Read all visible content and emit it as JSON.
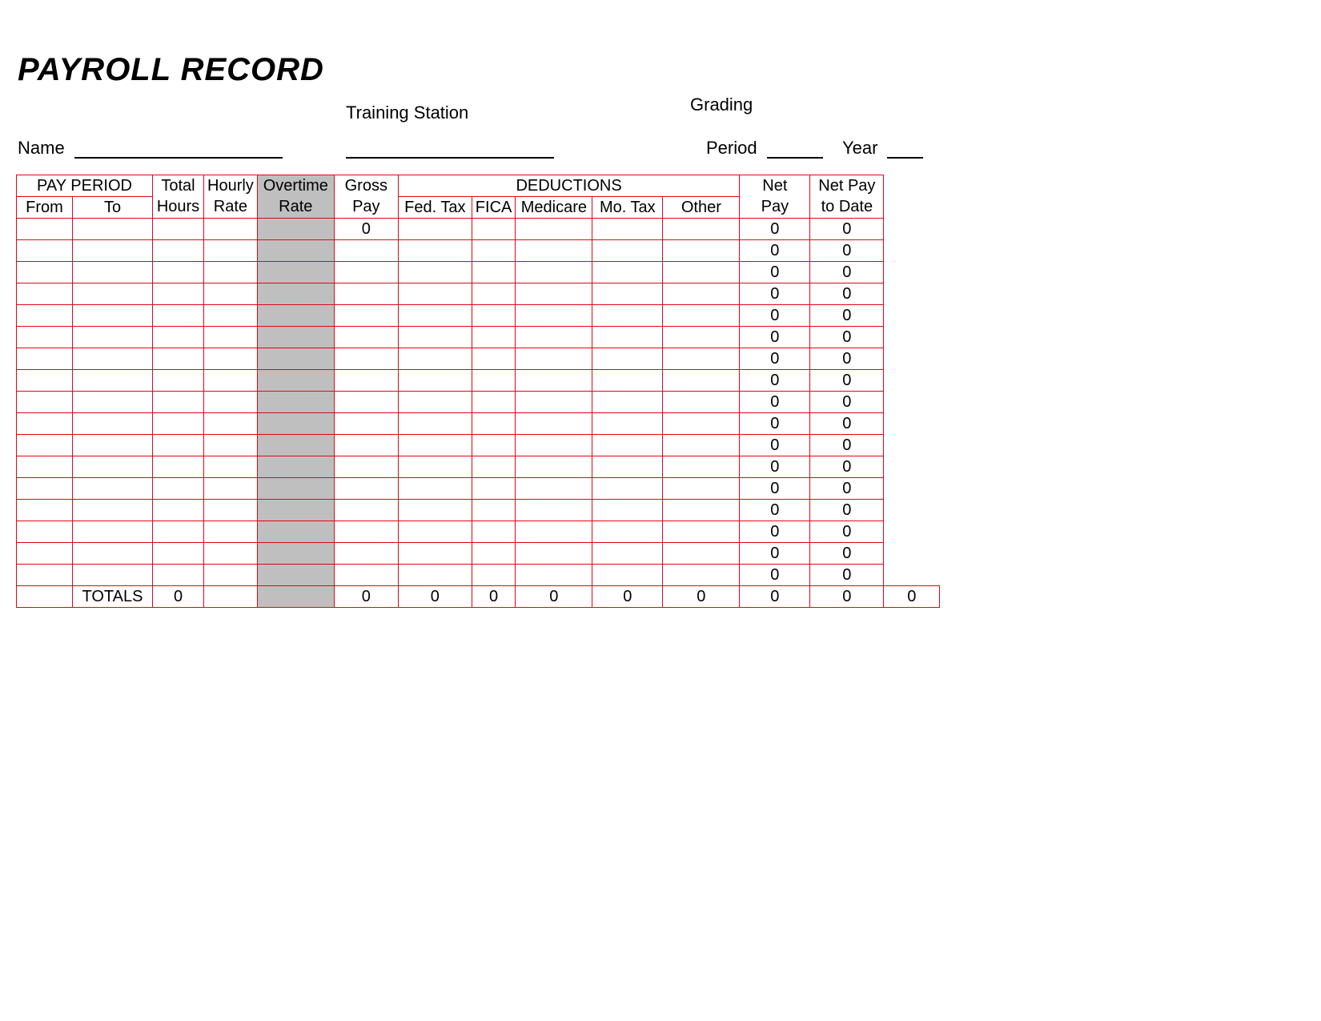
{
  "title": "PAYROLL RECORD",
  "header": {
    "name_label": "Name",
    "training_station_label": "Training Station",
    "grading_label": "Grading",
    "period_label": "Period",
    "year_label": "Year"
  },
  "columns": {
    "pay_period": "PAY PERIOD",
    "from": "From",
    "to": "To",
    "total_hours_1": "Total",
    "total_hours_2": "Hours",
    "hourly_rate_1": "Hourly",
    "hourly_rate_2": "Rate",
    "overtime_rate_1": "Overtime",
    "overtime_rate_2": "Rate",
    "gross_pay_1": "Gross",
    "gross_pay_2": "Pay",
    "deductions": "DEDUCTIONS",
    "fed_tax": "Fed. Tax",
    "fica": "FICA",
    "medicare": "Medicare",
    "mo_tax": "Mo. Tax",
    "other": "Other",
    "net_pay_1": "Net",
    "net_pay_2": "Pay",
    "net_pay_to_date_1": "Net Pay",
    "net_pay_to_date_2": "to Date"
  },
  "rows": [
    {
      "from": "",
      "to": "",
      "total_hours": "",
      "hourly_rate": "",
      "overtime_rate": "",
      "gross_pay": "0",
      "fed_tax": "",
      "fica": "",
      "medicare": "",
      "mo_tax": "",
      "other": "",
      "net_pay": "0",
      "net_pay_to_date": "0"
    },
    {
      "from": "",
      "to": "",
      "total_hours": "",
      "hourly_rate": "",
      "overtime_rate": "",
      "gross_pay": "",
      "fed_tax": "",
      "fica": "",
      "medicare": "",
      "mo_tax": "",
      "other": "",
      "net_pay": "0",
      "net_pay_to_date": "0"
    },
    {
      "from": "",
      "to": "",
      "total_hours": "",
      "hourly_rate": "",
      "overtime_rate": "",
      "gross_pay": "",
      "fed_tax": "",
      "fica": "",
      "medicare": "",
      "mo_tax": "",
      "other": "",
      "net_pay": "0",
      "net_pay_to_date": "0"
    },
    {
      "from": "",
      "to": "",
      "total_hours": "",
      "hourly_rate": "",
      "overtime_rate": "",
      "gross_pay": "",
      "fed_tax": "",
      "fica": "",
      "medicare": "",
      "mo_tax": "",
      "other": "",
      "net_pay": "0",
      "net_pay_to_date": "0"
    },
    {
      "from": "",
      "to": "",
      "total_hours": "",
      "hourly_rate": "",
      "overtime_rate": "",
      "gross_pay": "",
      "fed_tax": "",
      "fica": "",
      "medicare": "",
      "mo_tax": "",
      "other": "",
      "net_pay": "0",
      "net_pay_to_date": "0"
    },
    {
      "from": "",
      "to": "",
      "total_hours": "",
      "hourly_rate": "",
      "overtime_rate": "",
      "gross_pay": "",
      "fed_tax": "",
      "fica": "",
      "medicare": "",
      "mo_tax": "",
      "other": "",
      "net_pay": "0",
      "net_pay_to_date": "0"
    },
    {
      "from": "",
      "to": "",
      "total_hours": "",
      "hourly_rate": "",
      "overtime_rate": "",
      "gross_pay": "",
      "fed_tax": "",
      "fica": "",
      "medicare": "",
      "mo_tax": "",
      "other": "",
      "net_pay": "0",
      "net_pay_to_date": "0"
    },
    {
      "from": "",
      "to": "",
      "total_hours": "",
      "hourly_rate": "",
      "overtime_rate": "",
      "gross_pay": "",
      "fed_tax": "",
      "fica": "",
      "medicare": "",
      "mo_tax": "",
      "other": "",
      "net_pay": "0",
      "net_pay_to_date": "0"
    },
    {
      "from": "",
      "to": "",
      "total_hours": "",
      "hourly_rate": "",
      "overtime_rate": "",
      "gross_pay": "",
      "fed_tax": "",
      "fica": "",
      "medicare": "",
      "mo_tax": "",
      "other": "",
      "net_pay": "0",
      "net_pay_to_date": "0"
    },
    {
      "from": "",
      "to": "",
      "total_hours": "",
      "hourly_rate": "",
      "overtime_rate": "",
      "gross_pay": "",
      "fed_tax": "",
      "fica": "",
      "medicare": "",
      "mo_tax": "",
      "other": "",
      "net_pay": "0",
      "net_pay_to_date": "0"
    },
    {
      "from": "",
      "to": "",
      "total_hours": "",
      "hourly_rate": "",
      "overtime_rate": "",
      "gross_pay": "",
      "fed_tax": "",
      "fica": "",
      "medicare": "",
      "mo_tax": "",
      "other": "",
      "net_pay": "0",
      "net_pay_to_date": "0"
    },
    {
      "from": "",
      "to": "",
      "total_hours": "",
      "hourly_rate": "",
      "overtime_rate": "",
      "gross_pay": "",
      "fed_tax": "",
      "fica": "",
      "medicare": "",
      "mo_tax": "",
      "other": "",
      "net_pay": "0",
      "net_pay_to_date": "0"
    },
    {
      "from": "",
      "to": "",
      "total_hours": "",
      "hourly_rate": "",
      "overtime_rate": "",
      "gross_pay": "",
      "fed_tax": "",
      "fica": "",
      "medicare": "",
      "mo_tax": "",
      "other": "",
      "net_pay": "0",
      "net_pay_to_date": "0"
    },
    {
      "from": "",
      "to": "",
      "total_hours": "",
      "hourly_rate": "",
      "overtime_rate": "",
      "gross_pay": "",
      "fed_tax": "",
      "fica": "",
      "medicare": "",
      "mo_tax": "",
      "other": "",
      "net_pay": "0",
      "net_pay_to_date": "0"
    },
    {
      "from": "",
      "to": "",
      "total_hours": "",
      "hourly_rate": "",
      "overtime_rate": "",
      "gross_pay": "",
      "fed_tax": "",
      "fica": "",
      "medicare": "",
      "mo_tax": "",
      "other": "",
      "net_pay": "0",
      "net_pay_to_date": "0"
    },
    {
      "from": "",
      "to": "",
      "total_hours": "",
      "hourly_rate": "",
      "overtime_rate": "",
      "gross_pay": "",
      "fed_tax": "",
      "fica": "",
      "medicare": "",
      "mo_tax": "",
      "other": "",
      "net_pay": "0",
      "net_pay_to_date": "0"
    },
    {
      "from": "",
      "to": "",
      "total_hours": "",
      "hourly_rate": "",
      "overtime_rate": "",
      "gross_pay": "",
      "fed_tax": "",
      "fica": "",
      "medicare": "",
      "mo_tax": "",
      "other": "",
      "net_pay": "0",
      "net_pay_to_date": "0"
    }
  ],
  "totals": {
    "label": "TOTALS",
    "total_hours": "0",
    "hourly_rate": "",
    "overtime_rate": "",
    "gross_pay": "0",
    "fed_tax": "0",
    "fica": "0",
    "medicare": "0",
    "mo_tax": "0",
    "other": "0",
    "net_pay": "0",
    "net_pay_to_date": "0",
    "extra": "0"
  }
}
